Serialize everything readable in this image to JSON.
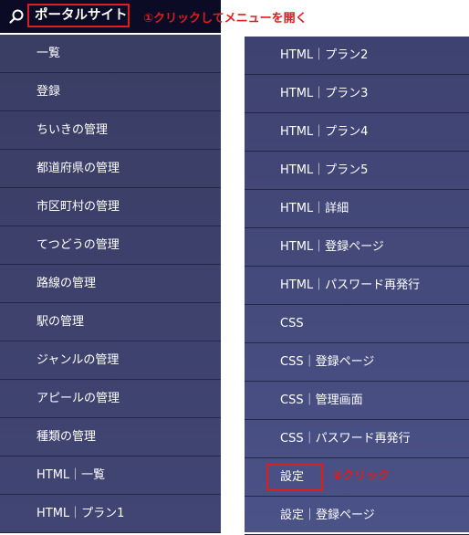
{
  "header": {
    "search_icon": "search-icon",
    "portal_label": "ポータルサイト"
  },
  "annotations": {
    "step1": "①クリックしてメニューを開く",
    "step2": "②クリック"
  },
  "colors": {
    "highlight": "#e21b1b",
    "menu_bg": "#3e4270",
    "header_bg": "#0b0b26"
  },
  "menu_left": [
    "一覧",
    "登録",
    "ちいきの管理",
    "都道府県の管理",
    "市区町村の管理",
    "てつどうの管理",
    "路線の管理",
    "駅の管理",
    "ジャンルの管理",
    "アピールの管理",
    "種類の管理",
    "HTML｜一覧",
    "HTML｜プラン1"
  ],
  "menu_right": [
    "HTML｜プラン2",
    "HTML｜プラン3",
    "HTML｜プラン4",
    "HTML｜プラン5",
    "HTML｜詳細",
    "HTML｜登録ページ",
    "HTML｜パスワード再発行",
    "CSS",
    "CSS｜登録ページ",
    "CSS｜管理画面",
    "CSS｜パスワード再発行",
    "設定",
    "設定｜登録ページ"
  ]
}
